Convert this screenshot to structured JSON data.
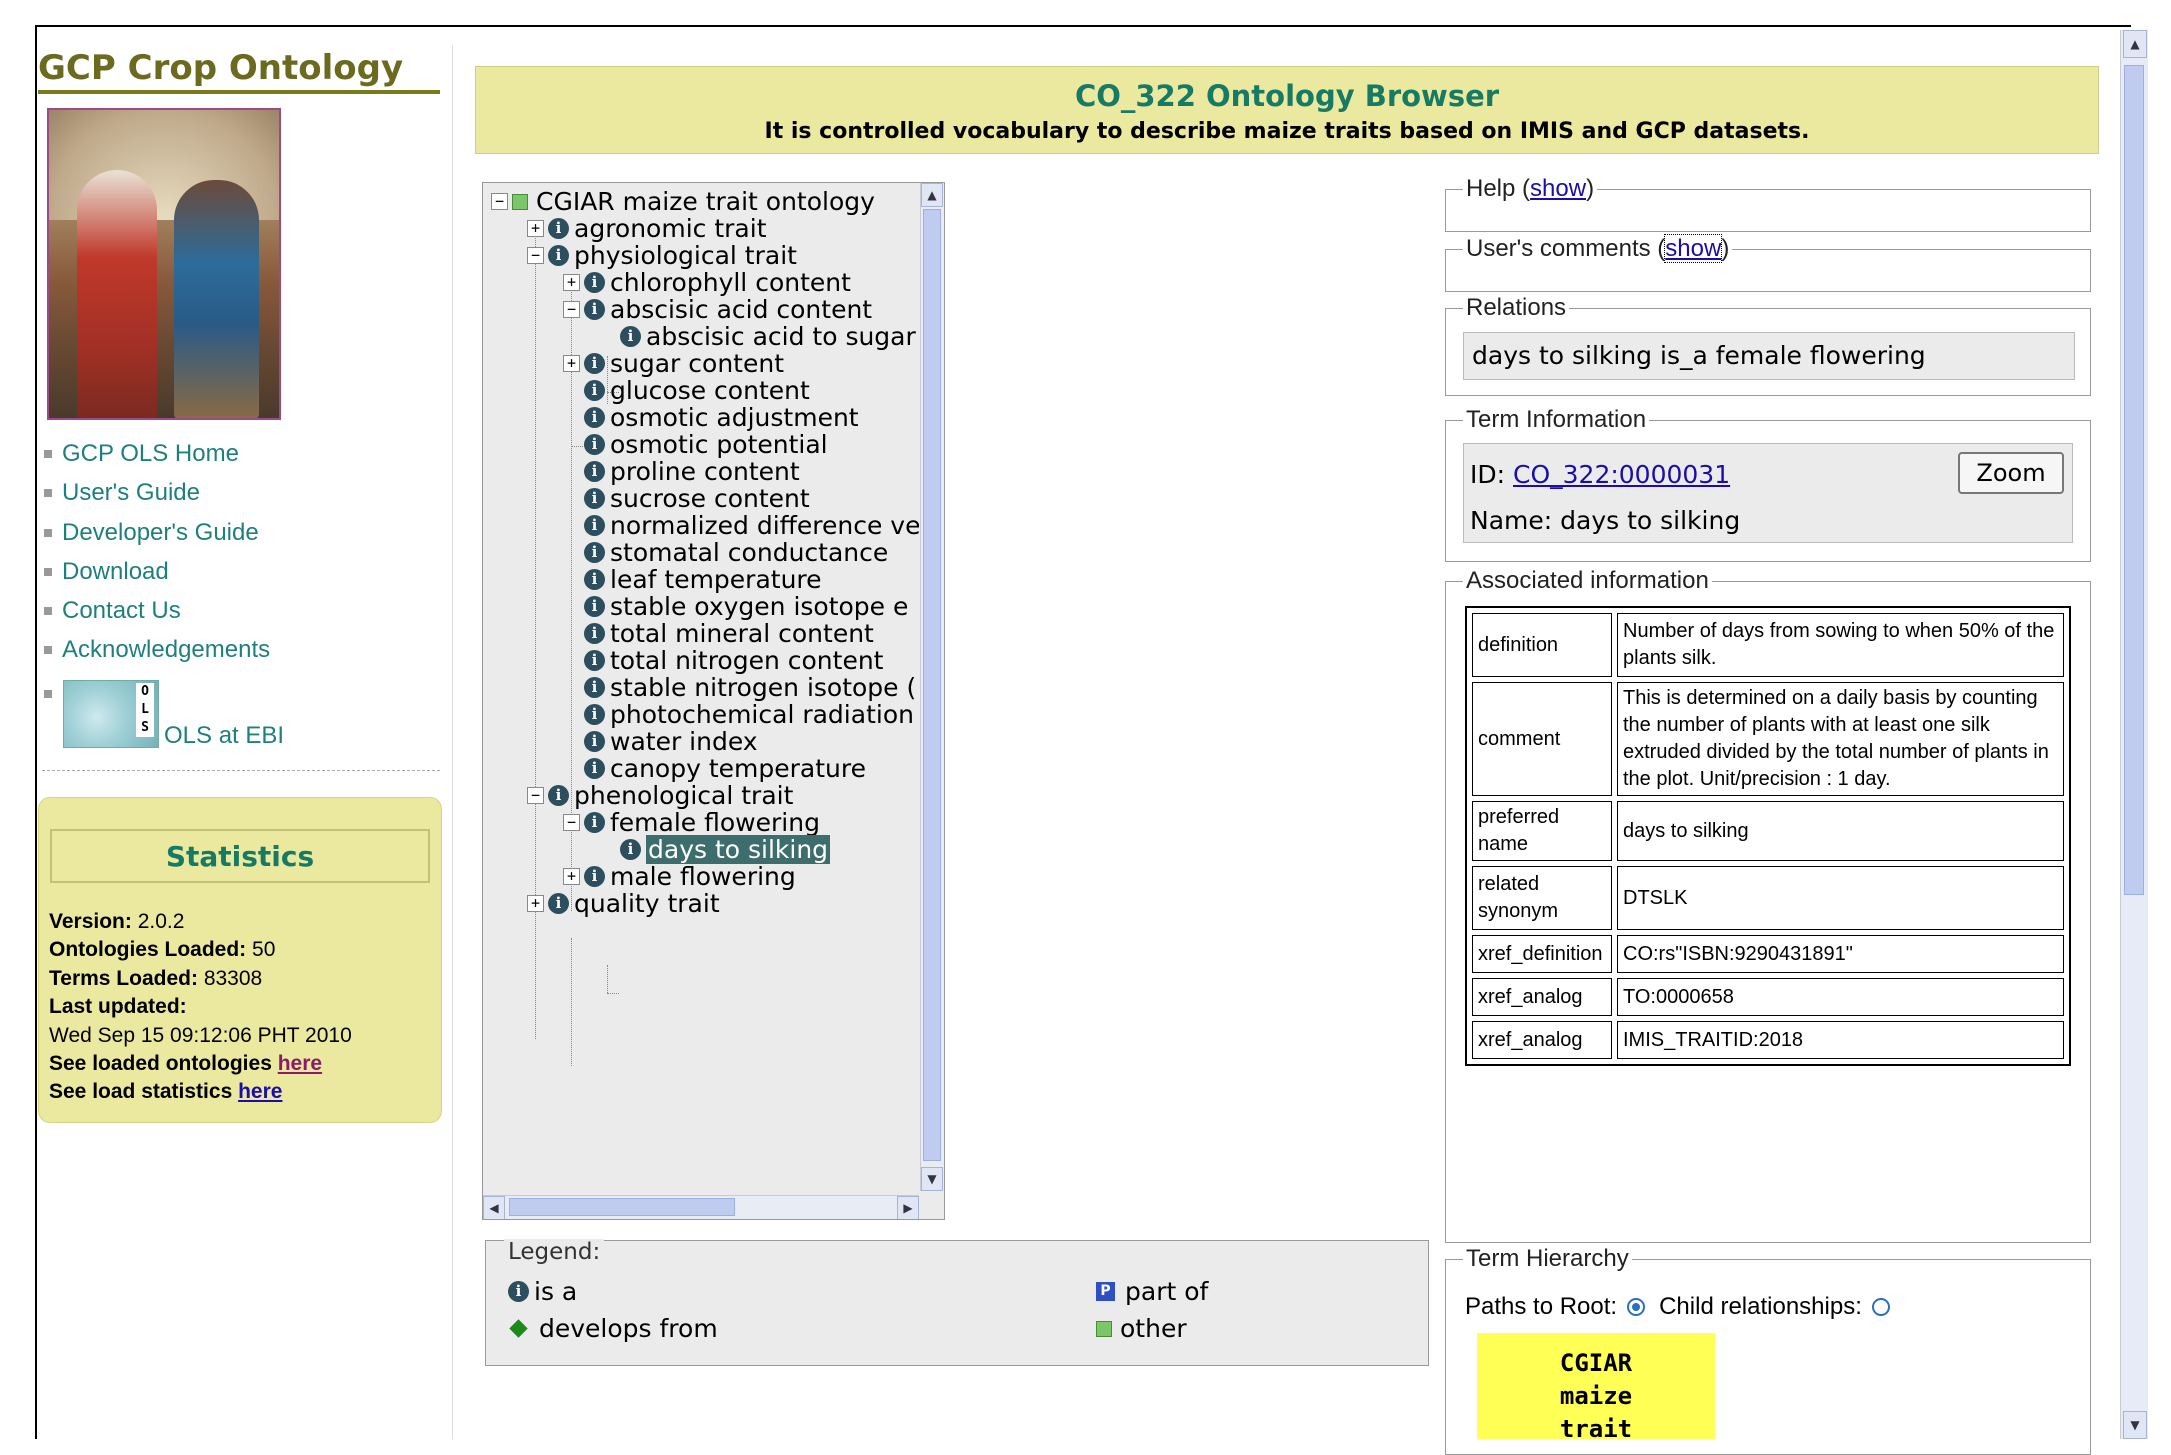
{
  "site": {
    "title": "GCP Crop Ontology"
  },
  "nav": [
    {
      "label": "GCP OLS Home"
    },
    {
      "label": "User's Guide"
    },
    {
      "label": "Developer's Guide"
    },
    {
      "label": "Download"
    },
    {
      "label": "Contact Us"
    },
    {
      "label": "Acknowledgements"
    }
  ],
  "ols_logo": {
    "letters": [
      "O",
      "L",
      "S"
    ],
    "label": "OLS at EBI"
  },
  "stats": {
    "title": "Statistics",
    "version_label": "Version:",
    "version": "2.0.2",
    "ontologies_label": "Ontologies Loaded:",
    "ontologies": "50",
    "terms_label": "Terms Loaded:",
    "terms": "83308",
    "updated_label": "Last updated:",
    "updated": "Wed Sep 15 09:12:06 PHT 2010",
    "loaded_prefix": "See loaded ontologies",
    "loaded_link": "here",
    "stats_prefix": "See load statistics",
    "stats_link": "here"
  },
  "banner": {
    "title": "CO_322 Ontology Browser",
    "subtitle": "It is controlled vocabulary to describe maize traits based on IMIS and GCP datasets."
  },
  "tree": {
    "root": "CGIAR maize trait ontology",
    "agronomic": "agronomic trait",
    "physiological": "physiological trait",
    "chlorophyll": "chlorophyll content",
    "abscisic": "abscisic acid content",
    "abscisic_sugar": "abscisic acid to sugar",
    "sugar": "sugar content",
    "glucose": "glucose content",
    "osmotic_adj": "osmotic adjustment",
    "osmotic_pot": "osmotic potential",
    "proline": "proline content",
    "sucrose": "sucrose content",
    "normalized": "normalized difference ve",
    "stomatal": "stomatal conductance",
    "leaf_temp": "leaf temperature",
    "oxygen": "stable oxygen isotope e",
    "mineral": "total mineral content",
    "nitrogen": "total nitrogen content",
    "nitrogen_iso": "stable nitrogen isotope (",
    "photochem": "photochemical radiation",
    "water": "water index",
    "canopy": "canopy temperature",
    "phenological": "phenological trait",
    "female": "female flowering",
    "silking": "days to silking",
    "male": "male flowering",
    "quality": "quality trait"
  },
  "legend": {
    "title": "Legend:",
    "is_a": "is a",
    "part_of": "part of",
    "develops_from": "develops from",
    "other": "other"
  },
  "help": {
    "label": "Help (",
    "link": "show",
    "close": ")"
  },
  "comments": {
    "label": "User's comments (",
    "link": "show",
    "close": ")"
  },
  "relations": {
    "label": "Relations",
    "text": "days to silking is_a female flowering"
  },
  "term_info": {
    "label": "Term Information",
    "id_label": "ID:",
    "id": "CO_322:0000031",
    "name_label": "Name:",
    "name": "days to silking",
    "zoom": "Zoom"
  },
  "assoc": {
    "label": "Associated information",
    "rows": [
      {
        "key": "definition",
        "value": "Number of days from sowing to when 50% of the plants silk."
      },
      {
        "key": "comment",
        "value": "This is determined on a daily basis by counting the number of plants with at least one silk extruded divided by the total number of plants in the plot. Unit/precision : 1 day."
      },
      {
        "key": "preferred name",
        "value": "days to silking"
      },
      {
        "key": "related synonym",
        "value": "DTSLK"
      },
      {
        "key": "xref_definition",
        "value": "CO:rs\"ISBN:9290431891\""
      },
      {
        "key": "xref_analog",
        "value": "TO:0000658"
      },
      {
        "key": "xref_analog",
        "value": "IMIS_TRAITID:2018"
      }
    ]
  },
  "hierarchy": {
    "label": "Term Hierarchy",
    "paths_label": "Paths to Root:",
    "child_label": "Child relationships:",
    "box": [
      "CGIAR",
      "maize",
      "trait"
    ]
  },
  "colors": {
    "accent": "#177a63",
    "banner_bg": "#ebe9a0",
    "link": "#1f7f7f",
    "selected": "#3d6d6d"
  }
}
